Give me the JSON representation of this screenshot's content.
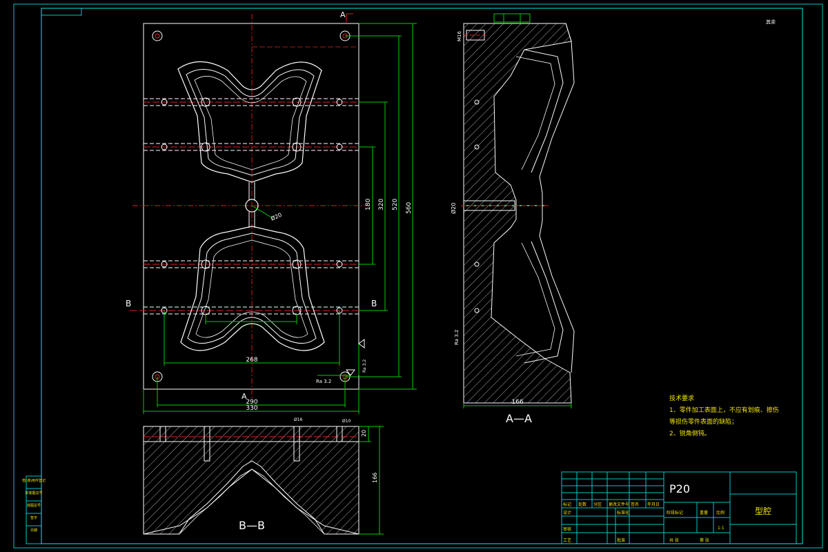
{
  "drawing": {
    "title_block": {
      "material": "P20",
      "part_name": "型腔",
      "scale": "1:1",
      "sheet_label": "共  张",
      "sheet_label2": "第  张",
      "row_labels": [
        "标记",
        "处数",
        "分区",
        "更改文件号",
        "签名",
        "年月日"
      ],
      "design": "设计",
      "standardize": "标准化",
      "process": "工艺",
      "approve": "批准",
      "review": "审核",
      "stage_mark": "阶段标记",
      "weight": "重量",
      "ratio": "比例"
    },
    "left_strip": [
      "借(通)用件登记",
      "旧底图总号",
      "底图总号",
      "签字",
      "日期"
    ],
    "notes": {
      "heading": "技术要求",
      "line1": "1、零件加工表面上，不应有划痕、擦伤",
      "line2": "等损伤零件表面的缺陷；",
      "line3": "2、锐角倒钝。"
    },
    "roughness_corner": "其余",
    "views": {
      "section_aa": "A—A",
      "section_bb": "B—B",
      "cut_a_top": "A",
      "cut_a_bottom": "A",
      "cut_b_left": "B",
      "cut_b_right": "B"
    },
    "dimensions": {
      "d180": "180",
      "d320": "320",
      "d520": "520",
      "d560": "560",
      "d268": "268",
      "d290": "290",
      "d330": "330",
      "d166": "166",
      "d166b": "166",
      "d20": "20",
      "phi20": "Ø20",
      "phi20_side": "Ø20",
      "m16": "M16",
      "phi16": "Ø16",
      "phi10": "Ø10",
      "ra32": "Ra 3.2"
    }
  }
}
